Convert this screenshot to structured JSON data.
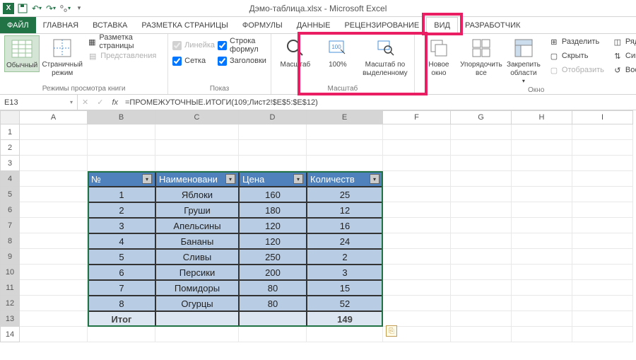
{
  "title": "Дэмо-таблица.xlsx - Microsoft Excel",
  "qat": {
    "save": "save",
    "undo": "undo",
    "redo": "redo"
  },
  "tabs": {
    "file": "ФАЙЛ",
    "items": [
      "ГЛАВНАЯ",
      "ВСТАВКА",
      "РАЗМЕТКА СТРАНИЦЫ",
      "ФОРМУЛЫ",
      "ДАННЫЕ",
      "РЕЦЕНЗИРОВАНИЕ",
      "ВИД",
      "РАЗРАБОТЧИК"
    ],
    "active": "ВИД"
  },
  "ribbon": {
    "views": {
      "normal": "Обычный",
      "page": "Страничный режим",
      "layout": "Разметка страницы",
      "custom": "Представления",
      "group": "Режимы просмотра книги"
    },
    "show": {
      "ruler": "Линейка",
      "formula": "Строка формул",
      "grid": "Сетка",
      "headings": "Заголовки",
      "group": "Показ"
    },
    "zoom": {
      "zoom": "Масштаб",
      "p100": "100%",
      "sel": "Масштаб по выделенному",
      "group": "Масштаб"
    },
    "window": {
      "neww": "Новое окно",
      "arrange": "Упорядочить все",
      "freeze": "Закрепить области",
      "split": "Разделить",
      "hide": "Скрыть",
      "unhide": "Отобразить",
      "side": "Рядом",
      "sync": "Синхр",
      "reset": "Восста",
      "group": "Окно"
    }
  },
  "formula": {
    "ref": "E13",
    "fx": "fx",
    "value": "=ПРОМЕЖУТОЧНЫЕ.ИТОГИ(109;Лист2!$E$5:$E$12)"
  },
  "cols": [
    "A",
    "B",
    "C",
    "D",
    "E",
    "F",
    "G",
    "H",
    "I"
  ],
  "widths": [
    96,
    96,
    118,
    96,
    108,
    96,
    86,
    86,
    86
  ],
  "rowcount": 14,
  "table": {
    "headers": [
      "№",
      "Наименовани",
      "Цена",
      "Количеств"
    ],
    "rows": [
      [
        "1",
        "Яблоки",
        "160",
        "25"
      ],
      [
        "2",
        "Груши",
        "180",
        "12"
      ],
      [
        "3",
        "Апельсины",
        "120",
        "16"
      ],
      [
        "4",
        "Бананы",
        "120",
        "24"
      ],
      [
        "5",
        "Сливы",
        "250",
        "2"
      ],
      [
        "6",
        "Персики",
        "200",
        "3"
      ],
      [
        "7",
        "Помидоры",
        "80",
        "15"
      ],
      [
        "8",
        "Огурцы",
        "80",
        "52"
      ]
    ],
    "total_label": "Итог",
    "total_value": "149"
  },
  "chart_data": {
    "type": "table",
    "title": "",
    "columns": [
      "№",
      "Наименование",
      "Цена",
      "Количество"
    ],
    "rows": [
      [
        1,
        "Яблоки",
        160,
        25
      ],
      [
        2,
        "Груши",
        180,
        12
      ],
      [
        3,
        "Апельсины",
        120,
        16
      ],
      [
        4,
        "Бананы",
        120,
        24
      ],
      [
        5,
        "Сливы",
        250,
        2
      ],
      [
        6,
        "Персики",
        200,
        3
      ],
      [
        7,
        "Помидоры",
        80,
        15
      ],
      [
        8,
        "Огурцы",
        80,
        52
      ]
    ],
    "totals": {
      "Количество": 149
    }
  }
}
